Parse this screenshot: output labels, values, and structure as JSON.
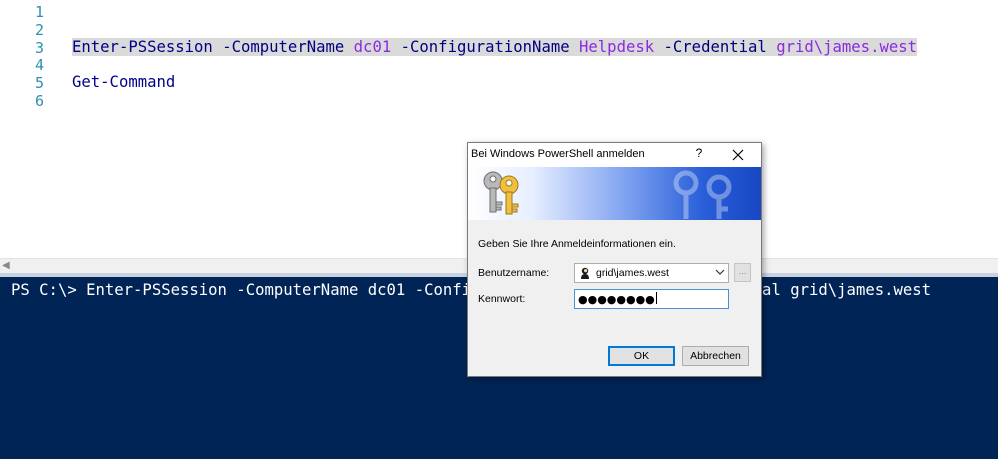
{
  "editor": {
    "line_numbers": [
      "1",
      "2",
      "3",
      "4",
      "5",
      "6"
    ],
    "line3": {
      "cmdlet": "Enter-PSSession",
      "param1": "-ComputerName",
      "arg1": "dc01",
      "param2": "-ConfigurationName",
      "arg2": "Helpdesk",
      "param3": "-Credential",
      "arg3": "grid\\james.west"
    },
    "line5": {
      "cmdlet": "Get-Command"
    }
  },
  "console": {
    "command_line": "PS C:\\> Enter-PSSession -ComputerName dc01 -ConfigurationName Helpdesk -Credential grid\\james.west"
  },
  "dialog": {
    "title": "Bei Windows PowerShell anmelden",
    "help_label": "?",
    "prompt": "Geben Sie Ihre Anmeldeinformationen ein.",
    "username_label": "Benutzername:",
    "username_value": "grid\\james.west",
    "password_label": "Kennwort:",
    "password_masked": "●●●●●●●●",
    "browse_label": "...",
    "ok_label": "OK",
    "cancel_label": "Abbrechen"
  },
  "colors": {
    "console_bg": "#012456",
    "cmdlet": "#00008b",
    "argument": "#8a2be2",
    "line_number": "#2b91af",
    "highlight": "#dadada"
  },
  "icons": {
    "keys": "keys-icon",
    "user": "user-avatar-icon",
    "close": "close-icon",
    "dropdown": "chevron-down-icon"
  }
}
